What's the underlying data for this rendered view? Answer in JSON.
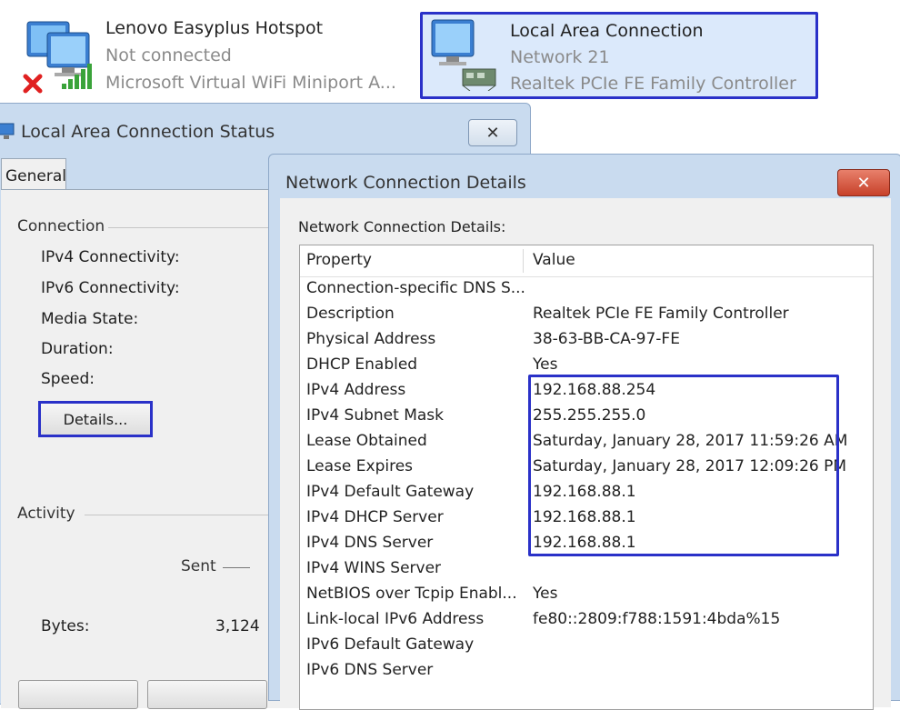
{
  "connections": [
    {
      "name": "Lenovo Easyplus Hotspot",
      "status": "Not connected",
      "adapter": "Microsoft Virtual WiFi Miniport A..."
    },
    {
      "name": "Local Area Connection",
      "status": "Network  21",
      "adapter": "Realtek PCIe FE Family Controller"
    }
  ],
  "status_window": {
    "title": "Local Area Connection Status",
    "close_symbol": "✕",
    "tab": "General",
    "connection_section": "Connection",
    "fields": [
      "IPv4 Connectivity:",
      "IPv6 Connectivity:",
      "Media State:",
      "Duration:",
      "Speed:"
    ],
    "details_button": "Details...",
    "activity_section": "Activity",
    "sent_label": "Sent",
    "bytes_label": "Bytes:",
    "bytes_sent": "3,124"
  },
  "details_dialog": {
    "title": "Network Connection Details",
    "close_symbol": "✕",
    "caption": "Network Connection Details:",
    "columns": {
      "property": "Property",
      "value": "Value"
    },
    "rows": [
      {
        "property": "Connection-specific DNS S...",
        "value": ""
      },
      {
        "property": "Description",
        "value": "Realtek PCIe FE Family Controller"
      },
      {
        "property": "Physical Address",
        "value": "38-63-BB-CA-97-FE"
      },
      {
        "property": "DHCP Enabled",
        "value": "Yes"
      },
      {
        "property": "IPv4 Address",
        "value": "192.168.88.254"
      },
      {
        "property": "IPv4 Subnet Mask",
        "value": "255.255.255.0"
      },
      {
        "property": "Lease Obtained",
        "value": "Saturday, January 28, 2017 11:59:26 AM"
      },
      {
        "property": "Lease Expires",
        "value": "Saturday, January 28, 2017 12:09:26 PM"
      },
      {
        "property": "IPv4 Default Gateway",
        "value": "192.168.88.1"
      },
      {
        "property": "IPv4 DHCP Server",
        "value": "192.168.88.1"
      },
      {
        "property": "IPv4 DNS Server",
        "value": "192.168.88.1"
      },
      {
        "property": "IPv4 WINS Server",
        "value": ""
      },
      {
        "property": "NetBIOS over Tcpip Enabl...",
        "value": "Yes"
      },
      {
        "property": "Link-local IPv6 Address",
        "value": "fe80::2809:f788:1591:4bda%15"
      },
      {
        "property": "IPv6 Default Gateway",
        "value": ""
      },
      {
        "property": "IPv6 DNS Server",
        "value": ""
      }
    ]
  },
  "colors": {
    "highlight": "#2a31c8",
    "title_bar": "#c9dbef",
    "close_red": "#c7412a"
  },
  "icons": [
    "network-computer-icon",
    "disconnected-x-icon",
    "signal-bars-icon",
    "network-adapter-icon",
    "close-icon"
  ]
}
